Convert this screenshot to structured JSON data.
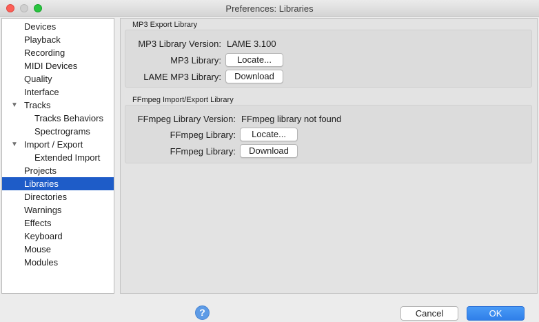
{
  "window": {
    "title": "Preferences: Libraries"
  },
  "sidebar": {
    "items": [
      {
        "label": "Devices",
        "level": 0,
        "expanded": null,
        "selected": false
      },
      {
        "label": "Playback",
        "level": 0,
        "expanded": null,
        "selected": false
      },
      {
        "label": "Recording",
        "level": 0,
        "expanded": null,
        "selected": false
      },
      {
        "label": "MIDI Devices",
        "level": 0,
        "expanded": null,
        "selected": false
      },
      {
        "label": "Quality",
        "level": 0,
        "expanded": null,
        "selected": false
      },
      {
        "label": "Interface",
        "level": 0,
        "expanded": null,
        "selected": false
      },
      {
        "label": "Tracks",
        "level": 0,
        "expanded": true,
        "selected": false
      },
      {
        "label": "Tracks Behaviors",
        "level": 1,
        "expanded": null,
        "selected": false
      },
      {
        "label": "Spectrograms",
        "level": 1,
        "expanded": null,
        "selected": false
      },
      {
        "label": "Import / Export",
        "level": 0,
        "expanded": true,
        "selected": false
      },
      {
        "label": "Extended Import",
        "level": 1,
        "expanded": null,
        "selected": false
      },
      {
        "label": "Projects",
        "level": 0,
        "expanded": null,
        "selected": false
      },
      {
        "label": "Libraries",
        "level": 0,
        "expanded": null,
        "selected": true
      },
      {
        "label": "Directories",
        "level": 0,
        "expanded": null,
        "selected": false
      },
      {
        "label": "Warnings",
        "level": 0,
        "expanded": null,
        "selected": false
      },
      {
        "label": "Effects",
        "level": 0,
        "expanded": null,
        "selected": false
      },
      {
        "label": "Keyboard",
        "level": 0,
        "expanded": null,
        "selected": false
      },
      {
        "label": "Mouse",
        "level": 0,
        "expanded": null,
        "selected": false
      },
      {
        "label": "Modules",
        "level": 0,
        "expanded": null,
        "selected": false
      }
    ],
    "expand_icon": "triangle-down-icon",
    "selected_color": "#1e5cc8"
  },
  "mp3": {
    "group_title": "MP3 Export Library",
    "version_label": "MP3 Library Version:",
    "version_value": "LAME 3.100",
    "library_label": "MP3 Library:",
    "locate_label": "Locate...",
    "lame_label": "LAME MP3 Library:",
    "download_label": "Download"
  },
  "ffmpeg": {
    "group_title": "FFmpeg Import/Export Library",
    "version_label": "FFmpeg Library Version:",
    "version_value": "FFmpeg library not found",
    "library_label": "FFmpeg Library:",
    "locate_label": "Locate...",
    "library_label_2": "FFmpeg Library:",
    "download_label": "Download"
  },
  "footer": {
    "help_icon": "question-mark-icon",
    "help_glyph": "?",
    "cancel_label": "Cancel",
    "ok_label": "OK",
    "ok_color": "#2f7fe9"
  }
}
